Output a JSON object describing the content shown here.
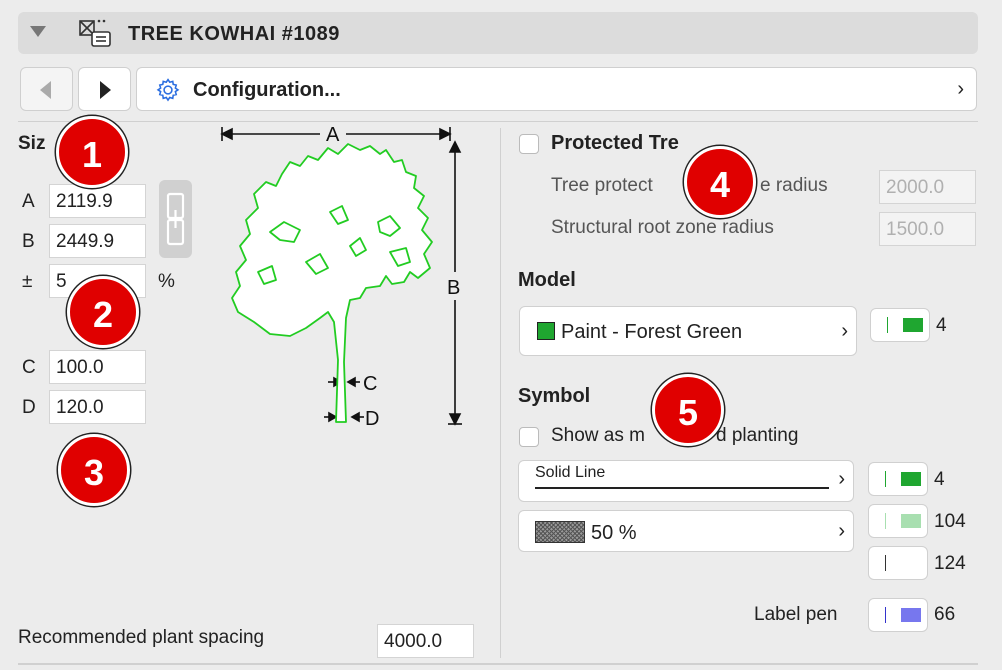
{
  "header": {
    "title": "TREE KOWHAI #1089"
  },
  "nav": {
    "config_label": "Configuration..."
  },
  "size": {
    "heading": "Siz",
    "a_label": "A",
    "a_value": "2119.9",
    "b_label": "B",
    "b_value": "2449.9",
    "pm_label": "±",
    "pm_value": "5",
    "pct_label": "%",
    "c_label": "C",
    "c_value": "100.0",
    "d_label": "D",
    "d_value": "120.0"
  },
  "diagram": {
    "a": "A",
    "b": "B",
    "c": "C",
    "d": "D"
  },
  "protected": {
    "label": "Protected Tre",
    "tpz_label": "Tree protect",
    "tpz_suffix": "e radius",
    "tpz_value": "2000.0",
    "srz_label": "Structural root zone radius",
    "srz_value": "1500.0"
  },
  "model": {
    "heading": "Model",
    "surface": "Paint - Forest Green",
    "pen": "4"
  },
  "symbol": {
    "heading": "Symbol",
    "show_label": "Show as m",
    "show_suffix": "d planting",
    "line_type": "Solid Line",
    "line_pen": "4",
    "fill_label": "50 %",
    "fill_pen": "104",
    "bg_pen": "124",
    "label_pen_label": "Label pen",
    "label_pen": "66"
  },
  "spacing": {
    "label": "Recommended plant spacing",
    "value": "4000.0"
  },
  "badges": {
    "b1": "1",
    "b2": "2",
    "b3": "3",
    "b4": "4",
    "b5": "5"
  },
  "colors": {
    "accent_green": "#1fa630",
    "light_green": "#a8dfb0",
    "label_blue": "#7777ee",
    "badge_red": "#e00000",
    "tree_outline": "#22cc22"
  },
  "icons": {
    "collapse": "triangle-down-icon",
    "object": "object-settings-icon",
    "prev": "arrow-left-icon",
    "next": "arrow-right-icon",
    "gear": "gear-icon",
    "link": "chain-link-icon"
  }
}
